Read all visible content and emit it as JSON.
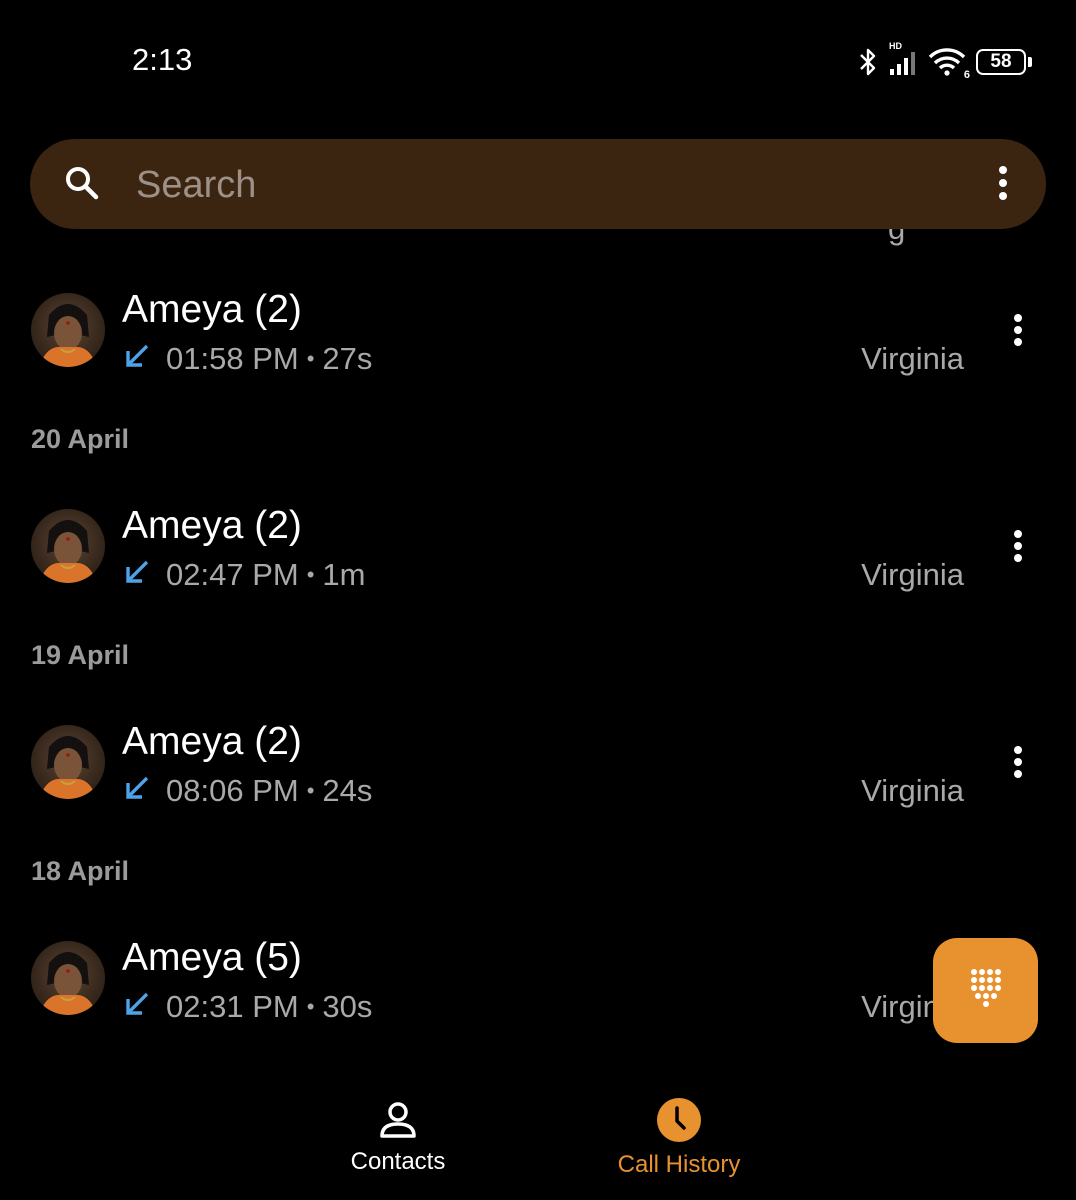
{
  "status_bar": {
    "time": "2:13",
    "battery_level": "58",
    "signal_tag": "HD",
    "wifi_tag": "6",
    "icons": [
      "bluetooth-icon",
      "signal-icon",
      "wifi-icon",
      "battery-icon"
    ]
  },
  "search": {
    "placeholder": "Search",
    "icon": "search-icon",
    "menu_icon": "more-vert-icon"
  },
  "call_log": {
    "clipped_fragment": "g",
    "groups": [
      {
        "date": "",
        "calls": [
          {
            "name": "Ameya (2)",
            "time": "01:58 PM",
            "duration": "27s",
            "separator": "•",
            "location": "Virginia",
            "direction": "incoming"
          }
        ]
      },
      {
        "date": "20 April",
        "calls": [
          {
            "name": "Ameya (2)",
            "time": "02:47 PM",
            "duration": "1m",
            "separator": "•",
            "location": "Virginia",
            "direction": "incoming"
          }
        ]
      },
      {
        "date": "19 April",
        "calls": [
          {
            "name": "Ameya (2)",
            "time": "08:06 PM",
            "duration": "24s",
            "separator": "•",
            "location": "Virginia",
            "direction": "incoming"
          }
        ]
      },
      {
        "date": "18 April",
        "calls": [
          {
            "name": "Ameya (5)",
            "time": "02:31 PM",
            "duration": "30s",
            "separator": "•",
            "location": "Virginia",
            "direction": "incoming"
          }
        ]
      }
    ]
  },
  "fab": {
    "icon": "dialpad-icon"
  },
  "bottom_nav": {
    "items": [
      {
        "label": "Contacts",
        "icon": "person-icon",
        "active": false
      },
      {
        "label": "Call History",
        "icon": "clock-icon",
        "active": true
      }
    ]
  },
  "colors": {
    "accent": "#e8922f",
    "search_bg": "#3b2510",
    "incoming_arrow": "#4ea3e8",
    "secondary_text": "#a9a9a9"
  }
}
